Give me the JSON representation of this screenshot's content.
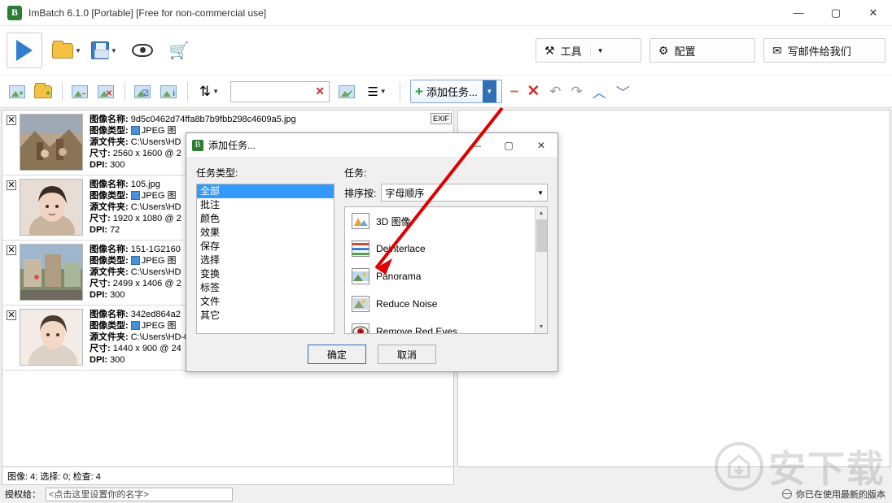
{
  "window": {
    "title": "ImBatch 6.1.0 [Portable] [Free for non-commercial use]",
    "logo": "B",
    "minimize": "—",
    "maximize": "▢",
    "close": "✕"
  },
  "toolbar_main": {
    "run_icon": "play-icon",
    "open_icon": "open-folder-icon",
    "save_icon": "save-icon",
    "preview_icon": "eye-icon",
    "buy_icon": "cart-icon",
    "tools_label": "工具",
    "config_label": "配置",
    "mail_label": "写邮件给我们"
  },
  "toolbar_second": {
    "add_image_icon": "add-image-icon",
    "add_folder_icon": "add-folder-icon",
    "remove_image_icon": "remove-image-icon",
    "remove_all_icon": "remove-all-images-icon",
    "check_all_icon": "check-all-icon",
    "info_icon": "image-info-icon",
    "sort_icon": "sort-icon",
    "search_placeholder": "",
    "search_value": "",
    "clear_label": "✕",
    "filter_icon": "filter-icon",
    "view_icon": "view-list-icon",
    "add_task_label": "添加任务...",
    "remove_task_label": "–",
    "delete_task_label": "✕",
    "undo_label": "↶",
    "redo_label": "↷",
    "move_up_label": "︿",
    "move_down_label": "﹀"
  },
  "images": [
    {
      "name_label": "图像名称:",
      "name": "9d5c0462d74ffa8b7b9fbb298c4609a5.jpg",
      "type_label": "图像类型:",
      "type": "JPEG 图",
      "folder_label": "源文件夹:",
      "folder": "C:\\Users\\HD",
      "size_label": "尺寸:",
      "size": "2560 x 1600 @ 2",
      "dpi_label": "DPI:",
      "dpi": "300",
      "exif": "EXIF",
      "checked": "✕",
      "thumb": "landscape-people"
    },
    {
      "name_label": "图像名称:",
      "name": "105.jpg",
      "type_label": "图像类型:",
      "type": "JPEG 图",
      "folder_label": "源文件夹:",
      "folder": "C:\\Users\\HD",
      "size_label": "尺寸:",
      "size": "1920 x 1080 @ 2",
      "dpi_label": "DPI:",
      "dpi": "72",
      "exif": "",
      "checked": "✕",
      "thumb": "portrait-woman"
    },
    {
      "name_label": "图像名称:",
      "name": "151-1G2160",
      "type_label": "图像类型:",
      "type": "JPEG 图",
      "folder_label": "源文件夹:",
      "folder": "C:\\Users\\HD",
      "size_label": "尺寸:",
      "size": "2499 x 1406 @ 2",
      "dpi_label": "DPI:",
      "dpi": "300",
      "exif": "",
      "checked": "✕",
      "thumb": "street-scene"
    },
    {
      "name_label": "图像名称:",
      "name": "342ed864a2",
      "type_label": "图像类型:",
      "type": "JPEG 图",
      "folder_label": "源文件夹:",
      "folder": "C:\\Users\\HD-06\\Pictures\\Saved Pictures\\",
      "size_label": "尺寸:",
      "size": "1440 x 900 @ 24",
      "dpi_label": "DPI:",
      "dpi": "300",
      "exif": "",
      "checked": "✕",
      "thumb": "girl-portrait"
    }
  ],
  "status": {
    "images_line": "图像: 4; 选择: 0; 检查: 4"
  },
  "bottom": {
    "license_label": "授权给：",
    "license_placeholder": "<点击这里设置你的名字>",
    "update_text": "你已在使用最新的版本"
  },
  "dialog": {
    "title": "添加任务...",
    "logo": "B",
    "minimize": "—",
    "maximize": "▢",
    "close": "✕",
    "type_label": "任务类型:",
    "tasks_label": "任务:",
    "sort_label": "排序按:",
    "sort_value": "字母顺序",
    "categories": [
      {
        "label": "全部",
        "selected": true
      },
      {
        "label": "批注",
        "selected": false
      },
      {
        "label": "颜色",
        "selected": false
      },
      {
        "label": "效果",
        "selected": false
      },
      {
        "label": "保存",
        "selected": false
      },
      {
        "label": "选择",
        "selected": false
      },
      {
        "label": "变换",
        "selected": false
      },
      {
        "label": "标签",
        "selected": false
      },
      {
        "label": "文件",
        "selected": false
      },
      {
        "label": "其它",
        "selected": false
      }
    ],
    "tasks": [
      {
        "label": "3D 图像",
        "icon": "3d-image-icon"
      },
      {
        "label": "Deinterlace",
        "icon": "deinterlace-icon"
      },
      {
        "label": "Panorama",
        "icon": "panorama-icon"
      },
      {
        "label": "Reduce Noise",
        "icon": "reduce-noise-icon"
      },
      {
        "label": "Remove Red Eyes",
        "icon": "remove-red-eyes-icon"
      }
    ],
    "ok_label": "确定",
    "cancel_label": "取消"
  },
  "watermark": {
    "text": "安下载",
    "url": "anxz.com"
  },
  "colors": {
    "accent": "#2f6fb5",
    "green": "#2f9e3f",
    "red": "#d03030",
    "select": "#3399ff",
    "arrow_annotation": "#e00000"
  }
}
